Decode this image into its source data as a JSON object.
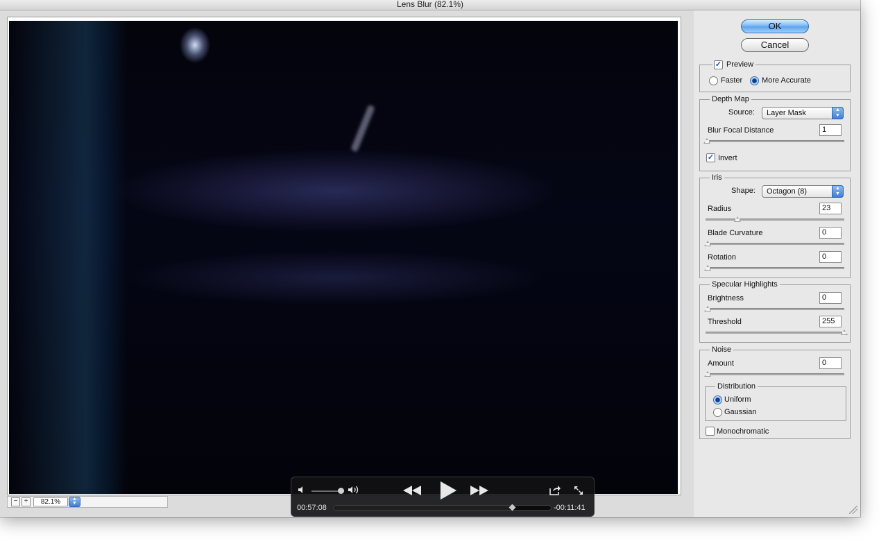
{
  "window": {
    "title": "Lens Blur (82.1%)"
  },
  "zoom": {
    "minus": "−",
    "plus": "+",
    "value": "82.1%",
    "stepper": "▲▼"
  },
  "buttons": {
    "ok": "OK",
    "cancel": "Cancel"
  },
  "preview": {
    "label": "Preview",
    "checked": true,
    "faster": "Faster",
    "more_accurate": "More Accurate",
    "mode": "More Accurate"
  },
  "depth_map": {
    "title": "Depth Map",
    "source_label": "Source:",
    "source_value": "Layer Mask",
    "focal_label": "Blur Focal Distance",
    "focal_value": "1",
    "focal_level": 0.01,
    "invert_label": "Invert",
    "invert_checked": true
  },
  "iris": {
    "title": "Iris",
    "shape_label": "Shape:",
    "shape_value": "Octagon (8)",
    "radius_label": "Radius",
    "radius_value": "23",
    "radius_level": 0.23,
    "curvature_label": "Blade Curvature",
    "curvature_value": "0",
    "rotation_label": "Rotation",
    "rotation_value": "0"
  },
  "specular": {
    "title": "Specular Highlights",
    "brightness_label": "Brightness",
    "brightness_value": "0",
    "threshold_label": "Threshold",
    "threshold_value": "255",
    "threshold_level": 1.0
  },
  "noise": {
    "title": "Noise",
    "amount_label": "Amount",
    "amount_value": "0",
    "distribution_title": "Distribution",
    "uniform": "Uniform",
    "gaussian": "Gaussian",
    "distribution": "Uniform",
    "mono_label": "Monochromatic",
    "mono_checked": false
  },
  "player": {
    "elapsed": "00:57:08",
    "remaining": "-00:11:41",
    "progress": 0.825,
    "icons": {
      "volume_low": "speaker-low-icon",
      "volume_high": "speaker-high-icon",
      "rewind": "rewind-icon",
      "play": "play-icon",
      "fast_forward": "fast-forward-icon",
      "share": "share-icon",
      "fullscreen": "fullscreen-icon"
    }
  },
  "colors": {
    "accent": "#4a90e2",
    "hud": "#121214"
  }
}
